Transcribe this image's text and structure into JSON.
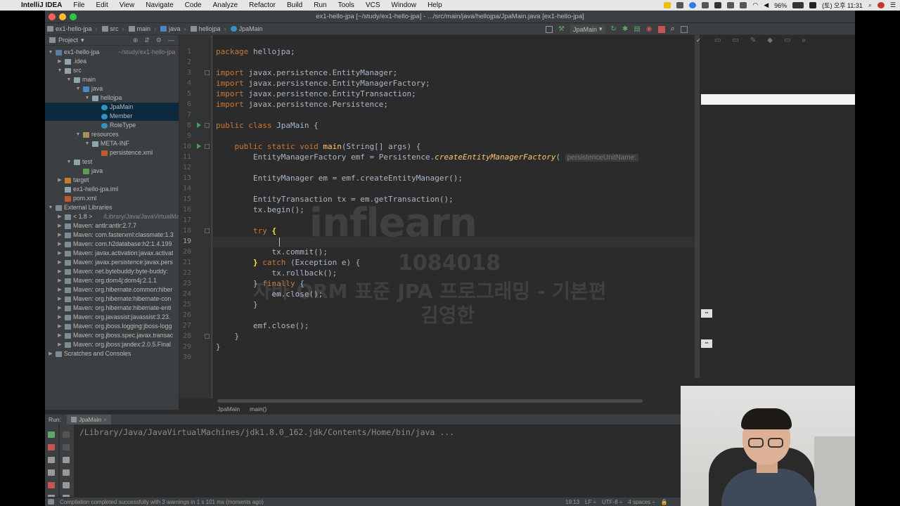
{
  "menubar": {
    "app": "IntelliJ IDEA",
    "items": [
      "File",
      "Edit",
      "View",
      "Navigate",
      "Code",
      "Analyze",
      "Refactor",
      "Build",
      "Run",
      "Tools",
      "VCS",
      "Window",
      "Help"
    ],
    "battery": "96%",
    "clock": "(토) 오후 11:31"
  },
  "window": {
    "title": "ex1-hello-jpa [~/study/ex1-hello-jpa] - .../src/main/java/hellojpa/JpaMain.java [ex1-hello-jpa]"
  },
  "navbar": {
    "crumbs": [
      "ex1-hello-jpa",
      "src",
      "main",
      "java",
      "hellojpa",
      "JpaMain"
    ],
    "run_config": "JpaMain"
  },
  "project": {
    "header": "Project",
    "tree": [
      {
        "label": "ex1-hello-jpa",
        "extra": "~/study/ex1-hello-jpa",
        "depth": 0,
        "arrow": "▼",
        "icon": "module"
      },
      {
        "label": ".idea",
        "depth": 1,
        "arrow": "▶",
        "icon": "folder"
      },
      {
        "label": "src",
        "depth": 1,
        "arrow": "▼",
        "icon": "folder"
      },
      {
        "label": "main",
        "depth": 2,
        "arrow": "▼",
        "icon": "folder"
      },
      {
        "label": "java",
        "depth": 3,
        "arrow": "▼",
        "icon": "folder-src"
      },
      {
        "label": "hellojpa",
        "depth": 4,
        "arrow": "▼",
        "icon": "folder"
      },
      {
        "label": "JpaMain",
        "depth": 5,
        "arrow": "",
        "icon": "class",
        "selected": true
      },
      {
        "label": "Member",
        "depth": 5,
        "arrow": "",
        "icon": "class",
        "selected": true
      },
      {
        "label": "RoleType",
        "depth": 5,
        "arrow": "",
        "icon": "class"
      },
      {
        "label": "resources",
        "depth": 3,
        "arrow": "▼",
        "icon": "folder-res"
      },
      {
        "label": "META-INF",
        "depth": 4,
        "arrow": "▼",
        "icon": "folder"
      },
      {
        "label": "persistence.xml",
        "depth": 5,
        "arrow": "",
        "icon": "xml"
      },
      {
        "label": "test",
        "depth": 2,
        "arrow": "▼",
        "icon": "folder"
      },
      {
        "label": "java",
        "depth": 3,
        "arrow": "",
        "icon": "folder-test"
      },
      {
        "label": "target",
        "depth": 1,
        "arrow": "▶",
        "icon": "folder-target"
      },
      {
        "label": "ex1-hello-jpa.iml",
        "depth": 1,
        "arrow": "",
        "icon": "file"
      },
      {
        "label": "pom.xml",
        "depth": 1,
        "arrow": "",
        "icon": "xml"
      },
      {
        "label": "External Libraries",
        "depth": 0,
        "arrow": "▼",
        "icon": "lib"
      },
      {
        "label": "< 1.8 >",
        "extra": "/Library/Java/JavaVirtualMac",
        "depth": 1,
        "arrow": "▶",
        "icon": "lib"
      },
      {
        "label": "Maven: antlr:antlr:2.7.7",
        "depth": 1,
        "arrow": "▶",
        "icon": "lib"
      },
      {
        "label": "Maven: com.fasterxml:classmate:1.3",
        "depth": 1,
        "arrow": "▶",
        "icon": "lib"
      },
      {
        "label": "Maven: com.h2database:h2:1.4.199",
        "depth": 1,
        "arrow": "▶",
        "icon": "lib"
      },
      {
        "label": "Maven: javax.activation:javax.activat",
        "depth": 1,
        "arrow": "▶",
        "icon": "lib"
      },
      {
        "label": "Maven: javax.persistence:javax.pers",
        "depth": 1,
        "arrow": "▶",
        "icon": "lib"
      },
      {
        "label": "Maven: net.bytebuddy:byte-buddy:",
        "depth": 1,
        "arrow": "▶",
        "icon": "lib"
      },
      {
        "label": "Maven: org.dom4j:dom4j:2.1.1",
        "depth": 1,
        "arrow": "▶",
        "icon": "lib"
      },
      {
        "label": "Maven: org.hibernate.common:hiber",
        "depth": 1,
        "arrow": "▶",
        "icon": "lib"
      },
      {
        "label": "Maven: org.hibernate:hibernate-con",
        "depth": 1,
        "arrow": "▶",
        "icon": "lib"
      },
      {
        "label": "Maven: org.hibernate:hibernate-enti",
        "depth": 1,
        "arrow": "▶",
        "icon": "lib"
      },
      {
        "label": "Maven: org.javassist:javassist:3.23.",
        "depth": 1,
        "arrow": "▶",
        "icon": "lib"
      },
      {
        "label": "Maven: org.jboss.logging:jboss-logg",
        "depth": 1,
        "arrow": "▶",
        "icon": "lib"
      },
      {
        "label": "Maven: org.jboss.spec.javax.transac",
        "depth": 1,
        "arrow": "▶",
        "icon": "lib"
      },
      {
        "label": "Maven: org.jboss:jandex:2.0.5.Final",
        "depth": 1,
        "arrow": "▶",
        "icon": "lib"
      },
      {
        "label": "Scratches and Consoles",
        "depth": 0,
        "arrow": "▶",
        "icon": "scratch"
      }
    ]
  },
  "editor": {
    "line_numbers": [
      "1",
      "2",
      "3",
      "4",
      "5",
      "6",
      "7",
      "8",
      "9",
      "10",
      "11",
      "12",
      "13",
      "14",
      "15",
      "16",
      "17",
      "18",
      "19",
      "20",
      "21",
      "22",
      "23",
      "24",
      "25",
      "26",
      "27",
      "28",
      "29",
      "30"
    ],
    "current_line": "19",
    "lines": [
      [
        {
          "t": "package ",
          "c": "kw"
        },
        {
          "t": "hellojpa;"
        }
      ],
      [],
      [
        {
          "t": "import ",
          "c": "kw"
        },
        {
          "t": "javax.persistence.EntityManager;"
        }
      ],
      [
        {
          "t": "import ",
          "c": "kw"
        },
        {
          "t": "javax.persistence.EntityManagerFactory;"
        }
      ],
      [
        {
          "t": "import ",
          "c": "kw"
        },
        {
          "t": "javax.persistence.EntityTransaction;"
        }
      ],
      [
        {
          "t": "import ",
          "c": "kw"
        },
        {
          "t": "javax.persistence.Persistence;"
        }
      ],
      [],
      [
        {
          "t": "public class ",
          "c": "kw"
        },
        {
          "t": "JpaMain {"
        }
      ],
      [],
      [
        {
          "t": "    public static void ",
          "c": "kw"
        },
        {
          "t": "main",
          "c": "fn"
        },
        {
          "t": "(String[] args) {"
        }
      ],
      [
        {
          "t": "        EntityManagerFactory emf = Persistence."
        },
        {
          "t": "createEntityManagerFactory",
          "c": "it"
        },
        {
          "t": "( "
        },
        {
          "t": "persistenceUnitName:",
          "c": "hint"
        }
      ],
      [],
      [
        {
          "t": "        EntityManager em = emf.createEntityManager();"
        }
      ],
      [],
      [
        {
          "t": "        EntityTransaction tx = em.getTransaction();"
        }
      ],
      [
        {
          "t": "        tx.begin();"
        }
      ],
      [],
      [
        {
          "t": "        "
        },
        {
          "t": "try ",
          "c": "kw"
        },
        {
          "t": "{",
          "c": "br"
        }
      ],
      [],
      [
        {
          "t": "            tx.commit();"
        }
      ],
      [
        {
          "t": "        "
        },
        {
          "t": "}",
          "c": "br"
        },
        {
          "t": " catch ",
          "c": "kw"
        },
        {
          "t": "(Exception e) {"
        }
      ],
      [
        {
          "t": "            tx.rollback();"
        }
      ],
      [
        {
          "t": "        } "
        },
        {
          "t": "finally ",
          "c": "kw"
        },
        {
          "t": "{"
        }
      ],
      [
        {
          "t": "            em.close();"
        }
      ],
      [
        {
          "t": "        }"
        }
      ],
      [],
      [
        {
          "t": "        emf.close();"
        }
      ],
      [
        {
          "t": "    }"
        }
      ],
      [
        {
          "t": "}"
        }
      ],
      []
    ],
    "breadcrumb": [
      "JpaMain",
      "main()"
    ]
  },
  "watermark": {
    "brand": "inflearn",
    "id": "1084018",
    "course": "자바 ORM 표준 JPA 프로그래밍 - 기본편",
    "author": "김영한"
  },
  "run": {
    "label": "Run:",
    "tab": "JpaMain",
    "console": "/Library/Java/JavaVirtualMachines/jdk1.8.0_162.jdk/Contents/Home/bin/java ..."
  },
  "status": {
    "message": "Compilation completed successfully with 3 warnings in 1 s 101 ms (moments ago)",
    "position": "19:13",
    "line_sep": "LF ÷",
    "encoding": "UTF-8 ÷",
    "indent": "4 spaces ÷"
  },
  "colors": {
    "editor_bg": "#2b2b2b",
    "keyword": "#cc7832",
    "method": "#ffc66d",
    "text": "#a9b7c6",
    "selection": "#0d293e"
  }
}
